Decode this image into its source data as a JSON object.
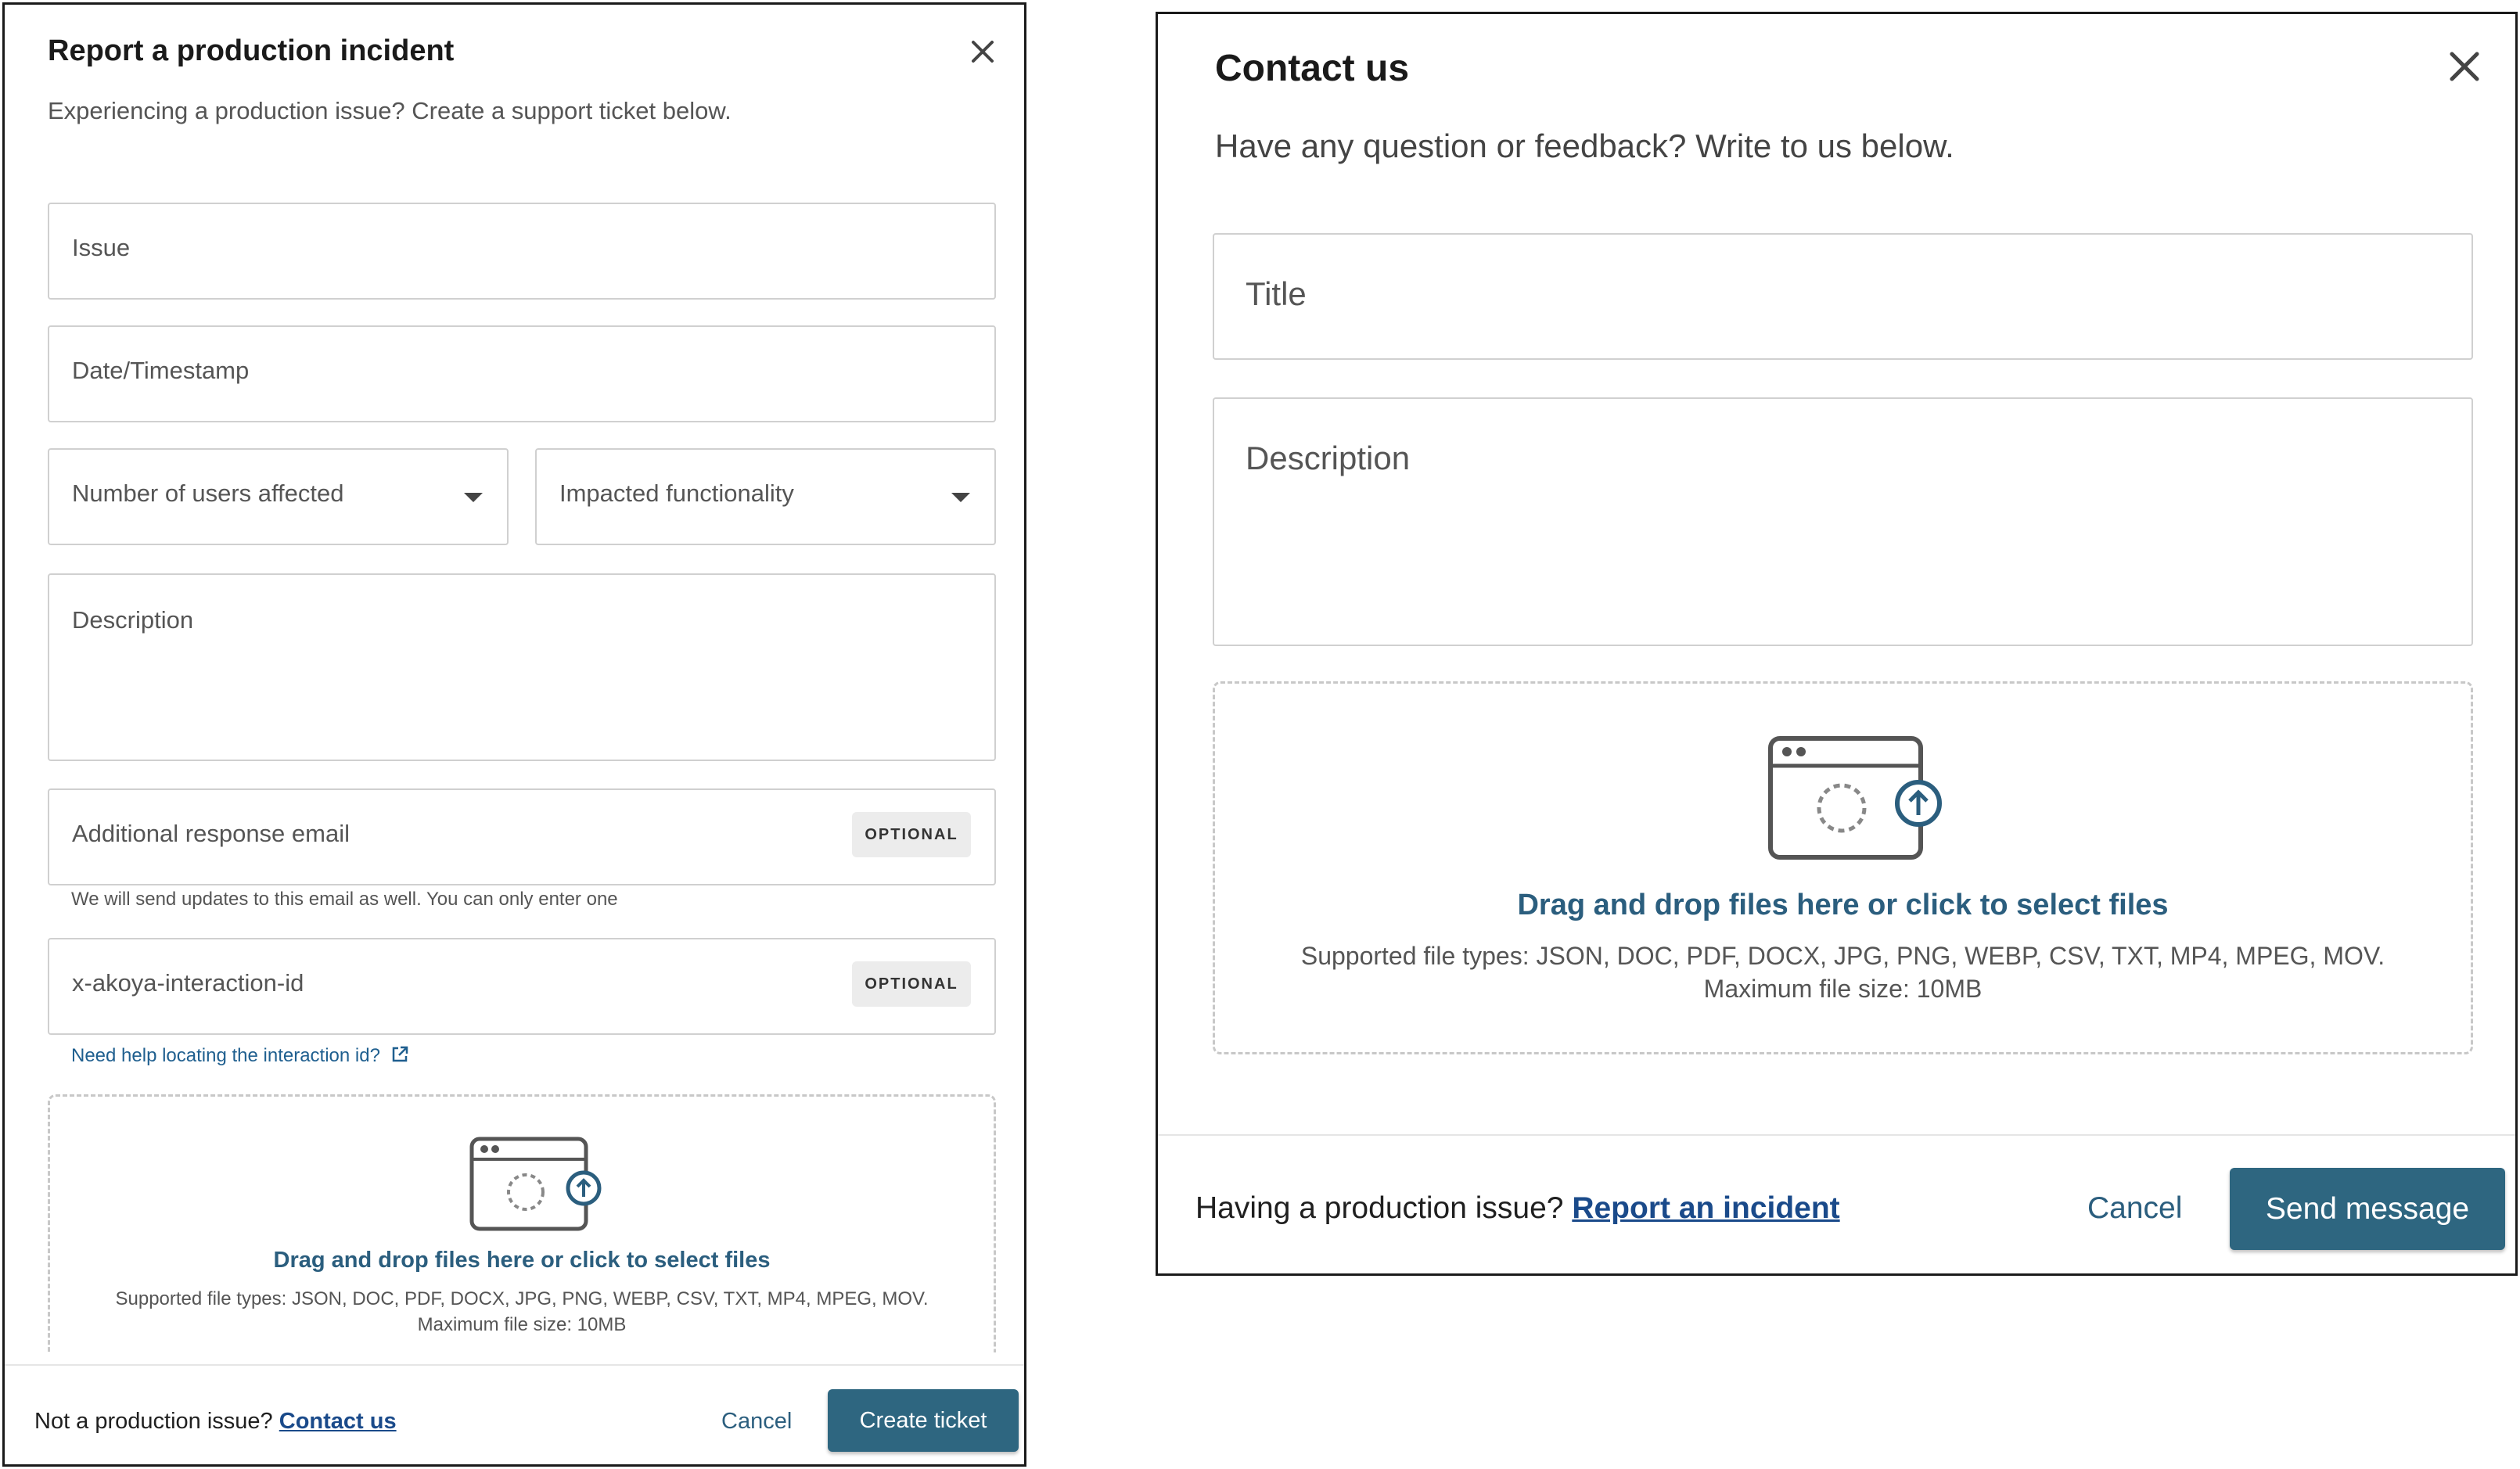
{
  "incident": {
    "title": "Report a production incident",
    "subtitle": "Experiencing a production issue? Create a support ticket below.",
    "issue_placeholder": "Issue",
    "date_placeholder": "Date/Timestamp",
    "users_affected_placeholder": "Number of users affected",
    "impacted_functionality_placeholder": "Impacted functionality",
    "description_placeholder": "Description",
    "email_placeholder": "Additional response email",
    "email_badge": "OPTIONAL",
    "email_helper": "We will send updates to this email as well. You can only enter one",
    "interaction_placeholder": "x-akoya-interaction-id",
    "interaction_badge": "OPTIONAL",
    "interaction_help_link": "Need help locating the interaction id?",
    "dropzone_title": "Drag and drop files here or click to select files",
    "dropzone_types": "Supported file types: JSON, DOC, PDF, DOCX, JPG, PNG, WEBP, CSV, TXT, MP4, MPEG, MOV.",
    "dropzone_max": "Maximum file size: 10MB",
    "footer_text": "Not a production issue?",
    "footer_link": "Contact us",
    "cancel_label": "Cancel",
    "submit_label": "Create ticket"
  },
  "contact": {
    "title": "Contact us",
    "subtitle": "Have any question or feedback? Write to us below.",
    "title_placeholder": "Title",
    "description_placeholder": "Description",
    "dropzone_title": "Drag and drop files here or click to select files",
    "dropzone_types": "Supported file types: JSON, DOC, PDF, DOCX, JPG, PNG, WEBP, CSV, TXT, MP4, MPEG, MOV.",
    "dropzone_max": "Maximum file size: 10MB",
    "footer_text": "Having a production issue?",
    "footer_link": "Report an incident",
    "cancel_label": "Cancel",
    "submit_label": "Send message"
  },
  "colors": {
    "primary": "#2e6680",
    "link": "#1a4a8a",
    "accent_text": "#2b5e7e",
    "border": "#d0d0d0"
  },
  "icons": [
    "close-icon",
    "chevron-down-icon",
    "external-link-icon",
    "file-upload-icon"
  ]
}
